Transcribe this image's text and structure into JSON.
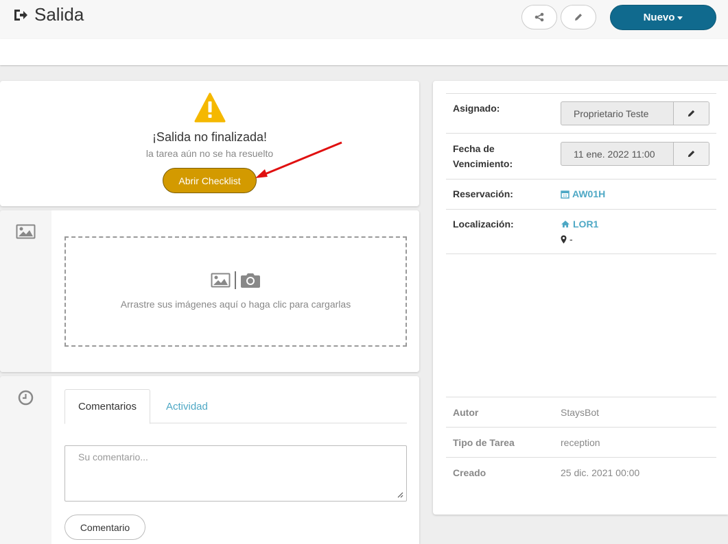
{
  "header": {
    "title": "Salida",
    "title_icon": "sign-out-icon",
    "share_icon": "share-icon",
    "edit_icon": "pencil-icon",
    "new_button": "Nuevo"
  },
  "status": {
    "icon": "warning-icon",
    "title": "¡Salida no finalizada!",
    "subtitle": "la tarea aún no se ha resuelto",
    "checklist_button": "Abrir Checklist",
    "accent": "#d39a00"
  },
  "upload": {
    "side_icon": "image-icon",
    "prompt": "Arrastre sus imágenes aquí o haga clic para cargarlas"
  },
  "comments": {
    "side_icon": "clock-icon",
    "tabs": [
      {
        "label": "Comentarios",
        "active": true
      },
      {
        "label": "Actividad",
        "active": false
      }
    ],
    "placeholder": "Su comentario...",
    "submit": "Comentario"
  },
  "details": {
    "assigned": {
      "label": "Asignado:",
      "value": "Proprietario Teste"
    },
    "due": {
      "label_line1": "Fecha de",
      "label_line2": "Vencimiento:",
      "value": "11 ene. 2022 11:00"
    },
    "reservation": {
      "label": "Reservación:",
      "value": "AW01H",
      "icon": "calendar-icon"
    },
    "location": {
      "label": "Localización:",
      "value": "LOR1",
      "icon": "home-icon",
      "address": "-",
      "address_icon": "map-marker-icon"
    },
    "meta": [
      {
        "label": "Autor",
        "value": "StaysBot"
      },
      {
        "label": "Tipo de Tarea",
        "value": "reception"
      },
      {
        "label": "Creado",
        "value": "25 dic. 2021 00:00"
      }
    ]
  },
  "colors": {
    "primary": "#106a8e",
    "link": "#4ea8c5",
    "warning": "#f5b800"
  }
}
